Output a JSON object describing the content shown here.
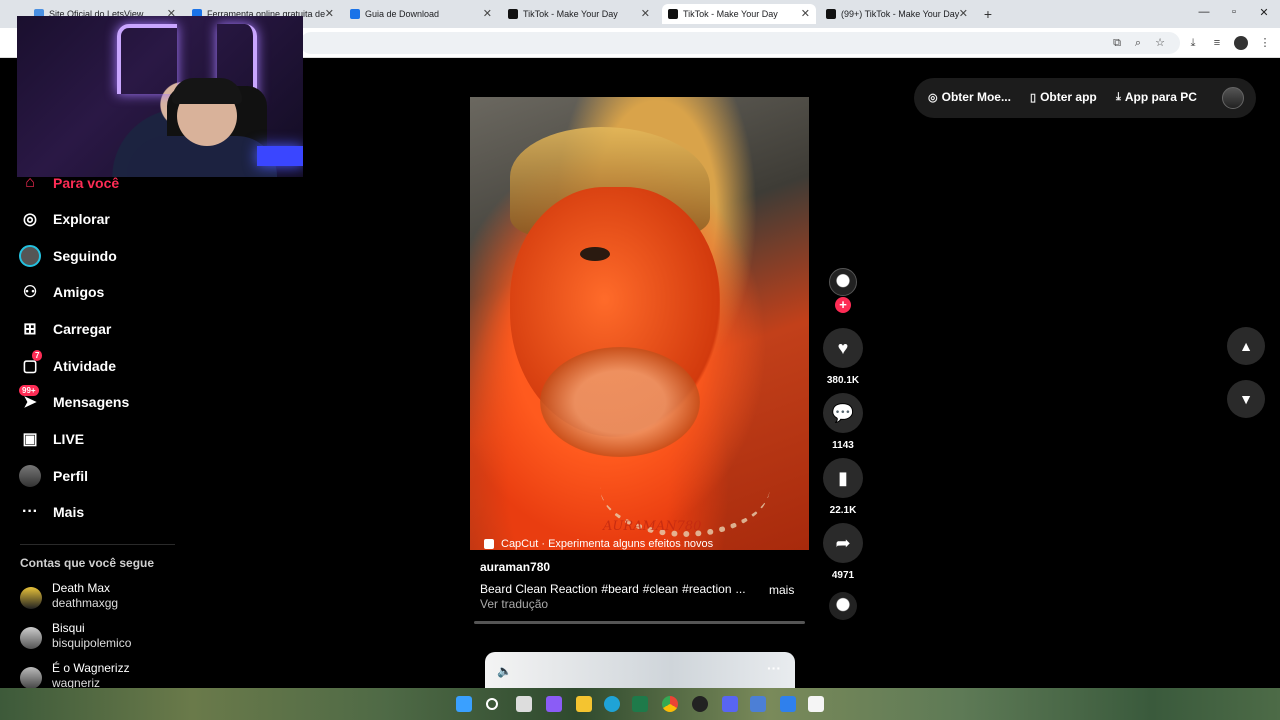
{
  "browser": {
    "tabs": [
      {
        "title": "Site Oficial do LetsView",
        "fav_color": "#4a90e2"
      },
      {
        "title": "Ferramenta online gratuita de",
        "fav_color": "#1a73e8"
      },
      {
        "title": "Guia de Download",
        "fav_color": "#1a73e8"
      },
      {
        "title": "TikTok - Make Your Day",
        "fav_color": "#111111"
      },
      {
        "title": "TikTok - Make Your Day",
        "fav_color": "#111111"
      },
      {
        "title": "(99+) TikTok - Make Your Day",
        "fav_color": "#111111"
      }
    ],
    "new_tab": "+",
    "close_glyph": "✕"
  },
  "sidebar": {
    "items": [
      {
        "label": "Para você",
        "icon": "home-icon",
        "glyph": "⌂"
      },
      {
        "label": "Explorar",
        "icon": "compass-icon",
        "glyph": "◎"
      },
      {
        "label": "Seguindo",
        "icon": "following-avatar-icon",
        "glyph": "◉"
      },
      {
        "label": "Amigos",
        "icon": "friends-icon",
        "glyph": "👥"
      },
      {
        "label": "Carregar",
        "icon": "upload-icon",
        "glyph": "⊞"
      },
      {
        "label": "Atividade",
        "icon": "activity-icon",
        "glyph": "▢",
        "badge": "7"
      },
      {
        "label": "Mensagens",
        "icon": "messages-icon",
        "glyph": "➤",
        "badge": "99+"
      },
      {
        "label": "LIVE",
        "icon": "live-tv-icon",
        "glyph": "📺"
      },
      {
        "label": "Perfil",
        "icon": "profile-avatar-icon",
        "glyph": "◕"
      },
      {
        "label": "Mais",
        "icon": "more-dots-icon",
        "glyph": "···"
      }
    ],
    "following_title": "Contas que você segue",
    "following": [
      {
        "name": "Death Max",
        "username": "deathmaxgg"
      },
      {
        "name": "Bisqui",
        "username": "bisquipolemico"
      },
      {
        "name": "É o Wagnerizz",
        "username": "wagneriz"
      }
    ]
  },
  "top_actions": {
    "coins": "Obter Moe...",
    "app": "Obter app",
    "pc_app": "App para PC"
  },
  "video": {
    "watermark": "AURAMAN780",
    "capcut": "CapCut · Experimenta alguns efeitos novos",
    "author": "auraman780",
    "description_parts": [
      "Beard Clean Reaction",
      "#beard",
      "#clean",
      "#reaction",
      "..."
    ],
    "more": "mais",
    "translate": "Ver tradução",
    "likes": "380.1K",
    "comments": "1143",
    "saves": "22.1K",
    "shares": "4971"
  },
  "next_video": {
    "dots": "···"
  }
}
